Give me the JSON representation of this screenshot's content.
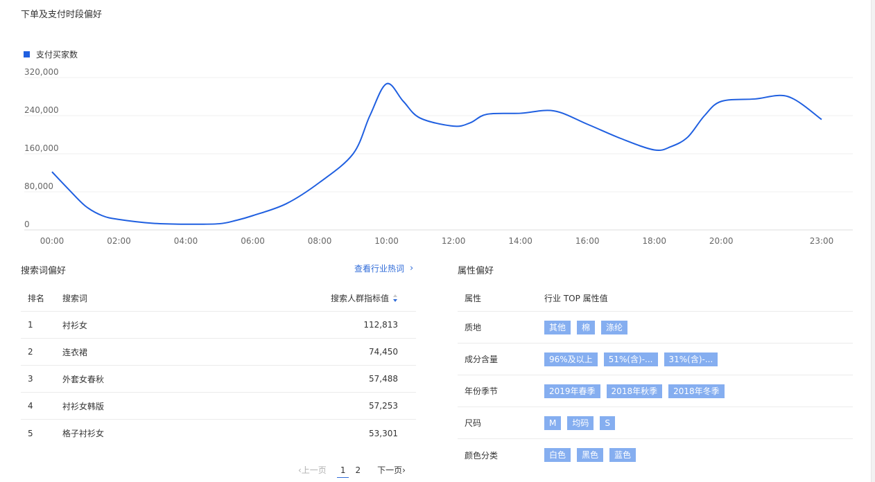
{
  "chart_section": {
    "title": "下单及支付时段偏好",
    "legend": "支付买家数"
  },
  "chart_data": {
    "type": "line",
    "title": "下单及支付时段偏好",
    "ylim": [
      0,
      320000
    ],
    "y_ticks": [
      0,
      80000,
      160000,
      240000,
      320000
    ],
    "y_tick_labels": [
      "0",
      "80,000",
      "160,000",
      "240,000",
      "320,000"
    ],
    "x_tick_labels": [
      "00:00",
      "02:00",
      "04:00",
      "06:00",
      "08:00",
      "10:00",
      "12:00",
      "14:00",
      "16:00",
      "18:00",
      "20:00",
      "23:00"
    ],
    "x_tick_hours": [
      0,
      2,
      4,
      6,
      8,
      10,
      12,
      14,
      16,
      18,
      20,
      23
    ],
    "color": "#1f5fe0",
    "series": [
      {
        "name": "支付买家数",
        "x": [
          0,
          0.5,
          1,
          1.5,
          2,
          3,
          4,
          5,
          5.5,
          6,
          7,
          8,
          9,
          9.5,
          10,
          10.5,
          11,
          12,
          12.5,
          13,
          14,
          15,
          16,
          17,
          18,
          18.5,
          19,
          19.5,
          20,
          21,
          22,
          23
        ],
        "y": [
          122000,
          85000,
          50000,
          30000,
          22000,
          14000,
          12000,
          13000,
          20000,
          30000,
          55000,
          100000,
          160000,
          240000,
          307000,
          270000,
          235000,
          218000,
          225000,
          243000,
          245000,
          250000,
          222000,
          192000,
          168000,
          175000,
          195000,
          240000,
          270000,
          275000,
          280000,
          232000
        ]
      }
    ]
  },
  "search_section": {
    "title": "搜索词偏好",
    "link": "查看行业热词",
    "link_chevron": "›",
    "headers": {
      "rank": "排名",
      "term": "搜索词",
      "value": "搜索人群指标值"
    },
    "rows": [
      {
        "rank": "1",
        "term": "衬衫女",
        "value": "112,813"
      },
      {
        "rank": "2",
        "term": "连衣裙",
        "value": "74,450"
      },
      {
        "rank": "3",
        "term": "外套女春秋",
        "value": "57,488"
      },
      {
        "rank": "4",
        "term": "衬衫女韩版",
        "value": "57,253"
      },
      {
        "rank": "5",
        "term": "格子衬衫女",
        "value": "53,301"
      }
    ],
    "pager": {
      "prev": "‹上一页",
      "page1": "1",
      "page2": "2",
      "next": "下一页›"
    }
  },
  "attr_section": {
    "title": "属性偏好",
    "headers": {
      "name": "属性",
      "values": "行业 TOP 属性值"
    },
    "rows": [
      {
        "name": "质地",
        "tags": [
          "其他",
          "棉",
          "涤纶"
        ]
      },
      {
        "name": "成分含量",
        "tags": [
          "96%及以上",
          "51%(含)-...",
          "31%(含)-..."
        ]
      },
      {
        "name": "年份季节",
        "tags": [
          "2019年春季",
          "2018年秋季",
          "2018年冬季"
        ]
      },
      {
        "name": "尺码",
        "tags": [
          "M",
          "均码",
          "S"
        ]
      },
      {
        "name": "颜色分类",
        "tags": [
          "白色",
          "黑色",
          "蓝色"
        ]
      }
    ],
    "tag_color": "#85aef0"
  }
}
